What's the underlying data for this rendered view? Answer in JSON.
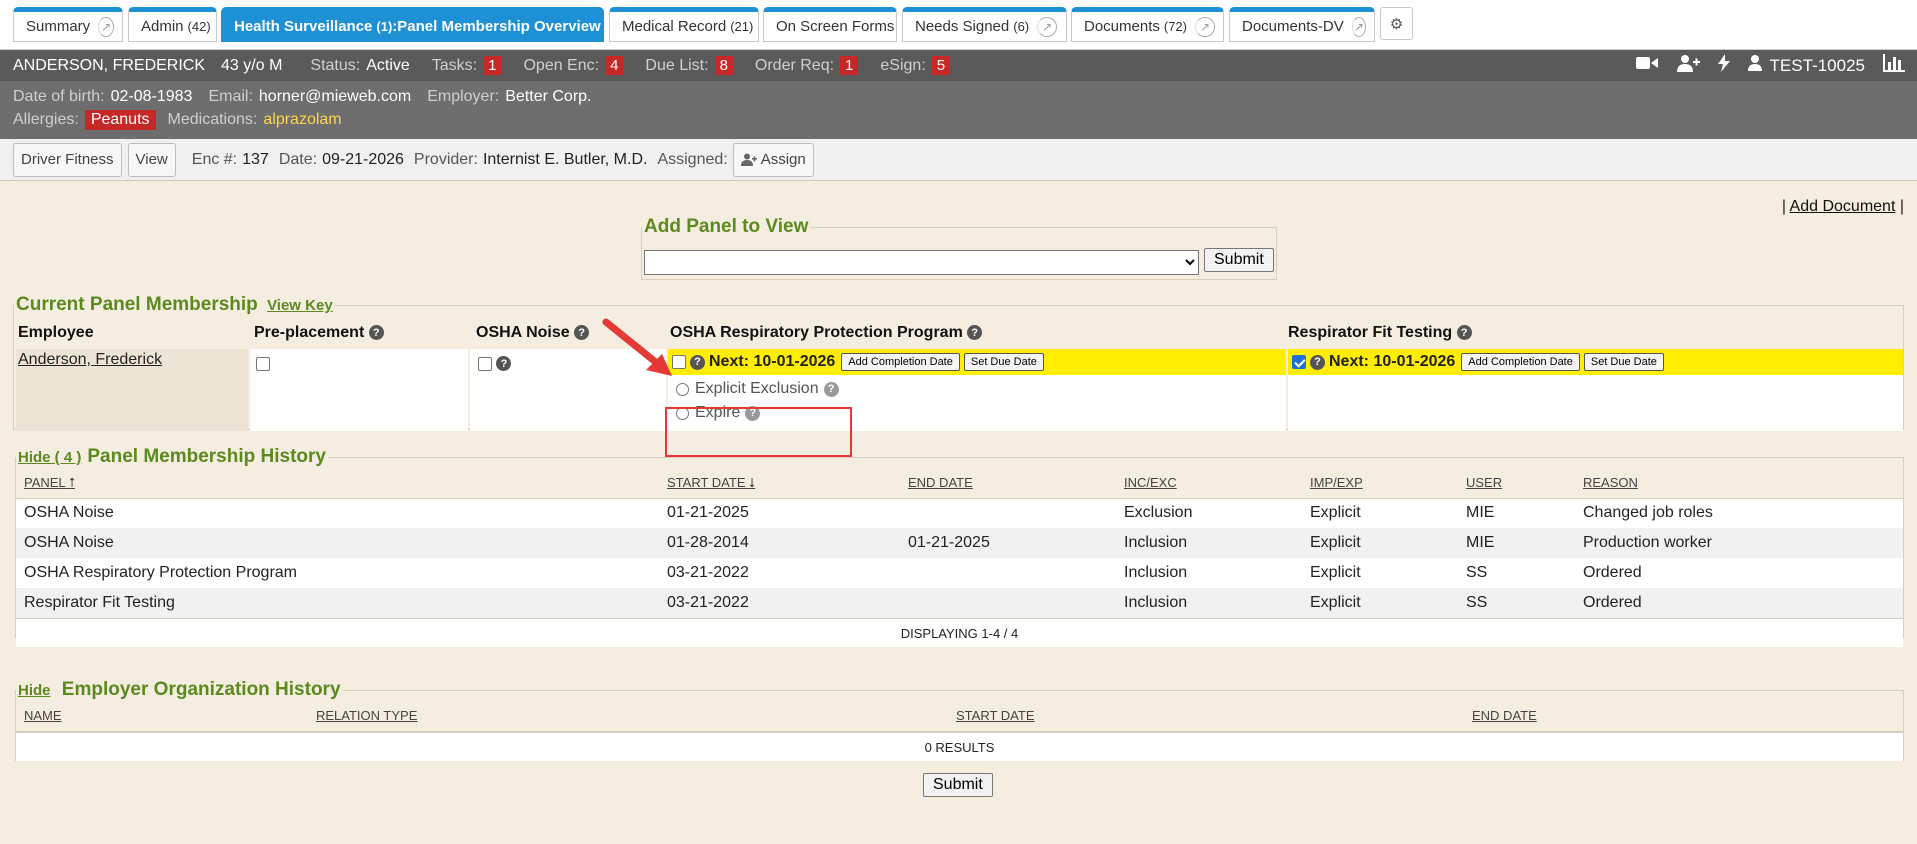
{
  "tabs": [
    {
      "label": "Summary",
      "count": "",
      "active": false
    },
    {
      "label": "Admin",
      "count": "(42)",
      "active": false
    },
    {
      "label": "Health Surveillance",
      "count": "(1)",
      "suffix": ":Panel Membership Overview",
      "active": true
    },
    {
      "label": "Medical Record",
      "count": "(21)",
      "active": false
    },
    {
      "label": "On Screen Forms",
      "count": "",
      "active": false
    },
    {
      "label": "Needs Signed",
      "count": "(6)",
      "active": false
    },
    {
      "label": "Documents",
      "count": "(72)",
      "active": false
    },
    {
      "label": "Documents-DV",
      "count": "",
      "active": false
    }
  ],
  "patient": {
    "name": "ANDERSON, FREDERICK",
    "age_sex": "43 y/o M",
    "status_label": "Status:",
    "status": "Active",
    "tasks_label": "Tasks:",
    "tasks": "1",
    "open_enc_label": "Open Enc:",
    "open_enc": "4",
    "due_list_label": "Due List:",
    "due_list": "8",
    "order_req_label": "Order Req:",
    "order_req": "1",
    "esign_label": "eSign:",
    "esign": "5",
    "account": "TEST-10025",
    "dob_label": "Date of birth:",
    "dob": "02-08-1983",
    "email_label": "Email:",
    "email": "horner@mieweb.com",
    "employer_label": "Employer:",
    "employer": "Better Corp.",
    "allergies_label": "Allergies:",
    "allergies": "Peanuts",
    "medications_label": "Medications:",
    "medications": "alprazolam"
  },
  "encounter": {
    "driver_fitness": "Driver Fitness",
    "view": "View",
    "enc_label": "Enc #:",
    "enc": "137",
    "date_label": "Date:",
    "date": "09-21-2026",
    "provider_label": "Provider:",
    "provider": "Internist E. Butler, M.D.",
    "assigned_label": "Assigned:",
    "assign_button": "Assign"
  },
  "add_document": "Add Document",
  "add_panel": {
    "legend": "Add Panel to View",
    "select_value": "",
    "submit": "Submit"
  },
  "current_panel": {
    "legend": "Current Panel Membership",
    "view_key": "View Key",
    "headers": [
      "Employee",
      "Pre-placement",
      "OSHA Noise",
      "OSHA Respiratory Protection Program",
      "Respirator Fit Testing"
    ],
    "employee": "Anderson, Frederick",
    "osha_resp": {
      "next": "Next: 10-01-2026",
      "add_completion": "Add Completion Date",
      "set_due": "Set Due Date",
      "explicit_exclusion": "Explicit Exclusion",
      "expire": "Expire"
    },
    "fit_testing": {
      "next": "Next: 10-01-2026",
      "add_completion": "Add Completion Date",
      "set_due": "Set Due Date"
    }
  },
  "panel_history": {
    "hide": "Hide ( 4 )",
    "legend": "Panel Membership History",
    "columns": [
      "PANEL",
      "START DATE",
      "END DATE",
      "INC/EXC",
      "IMP/EXP",
      "USER",
      "REASON"
    ],
    "rows": [
      [
        "OSHA Noise",
        "01-21-2025",
        "",
        "Exclusion",
        "Explicit",
        "MIE",
        "Changed job roles"
      ],
      [
        "OSHA Noise",
        "01-28-2014",
        "01-21-2025",
        "Inclusion",
        "Explicit",
        "MIE",
        "Production worker"
      ],
      [
        "OSHA Respiratory Protection Program",
        "03-21-2022",
        "",
        "Inclusion",
        "Explicit",
        "SS",
        "Ordered"
      ],
      [
        "Respirator Fit Testing",
        "03-21-2022",
        "",
        "Inclusion",
        "Explicit",
        "SS",
        "Ordered"
      ]
    ],
    "footer": "DISPLAYING 1-4 / 4"
  },
  "employer_history": {
    "hide": "Hide",
    "legend": "Employer Organization History",
    "columns": [
      "NAME",
      "RELATION TYPE",
      "START DATE",
      "END DATE"
    ],
    "footer": "0 RESULTS"
  },
  "submit": "Submit",
  "colors": {
    "accent": "#1e90d6",
    "legend_green": "#5b8a1e",
    "alert_red": "#c62828",
    "next_yellow": "#ffee00"
  }
}
